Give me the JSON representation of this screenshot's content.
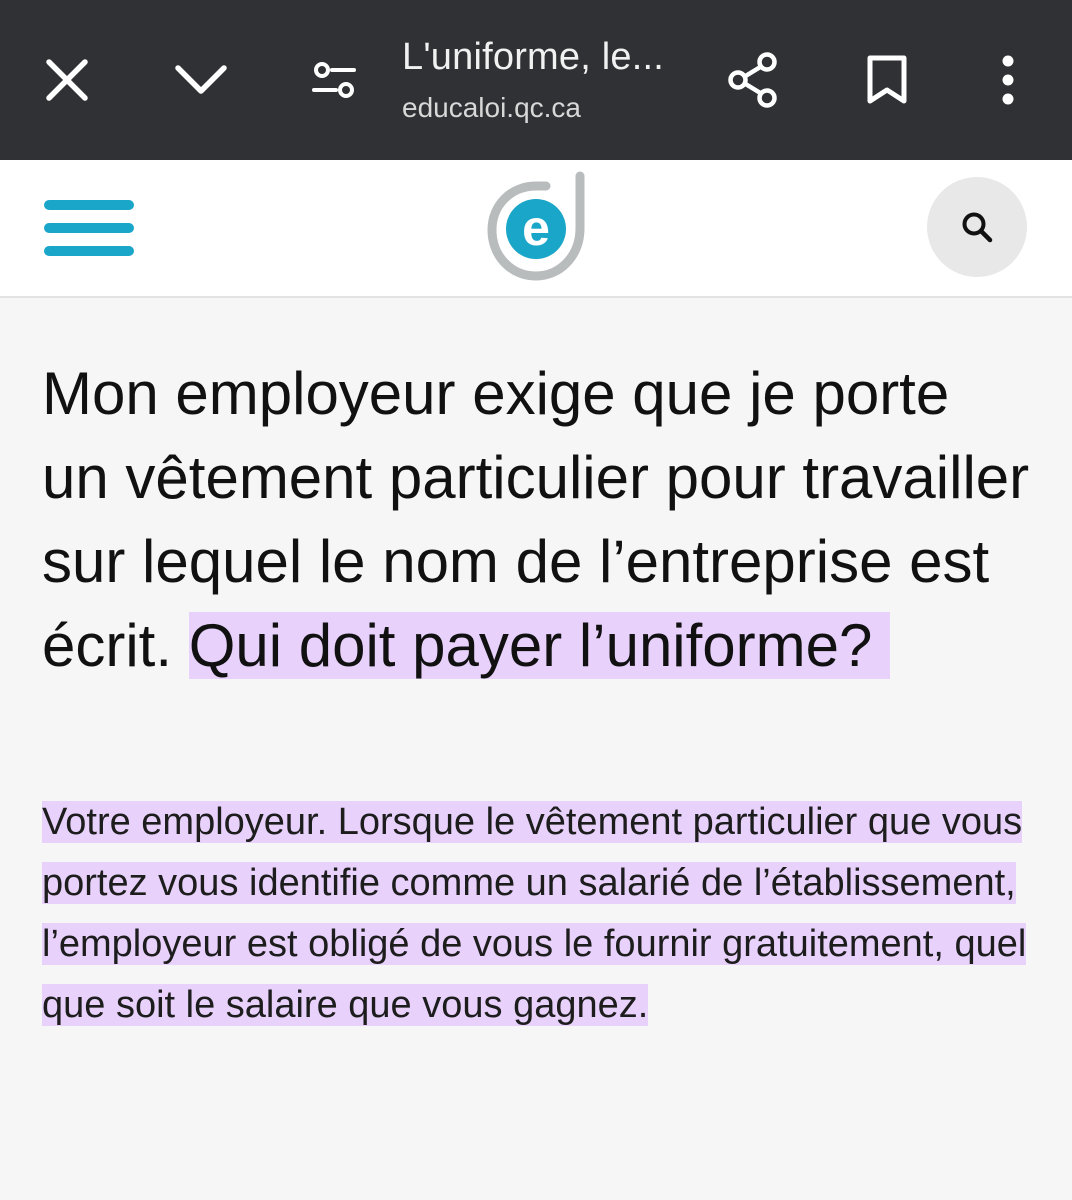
{
  "browser": {
    "page_title": "L'uniforme, le...",
    "url": "educaloi.qc.ca",
    "icons": {
      "close": "close-icon",
      "minimize": "chevron-down-icon",
      "site_settings": "tune-icon",
      "share": "share-icon",
      "bookmark": "bookmark-icon",
      "more": "more-vert-icon"
    }
  },
  "site": {
    "logo_letter": "e",
    "menu_icon": "hamburger-icon",
    "search_icon": "search-icon",
    "brand_color": "#1aa6c8"
  },
  "article": {
    "question_plain": "Mon employeur exige que je porte un vêtement particulier pour travailler sur lequel le nom de l’entreprise est écrit. ",
    "question_highlight": "Qui doit payer l’uniforme?",
    "answer": "Votre employeur. Lorsque le vêtement particulier que vous portez vous identifie comme un salarié de l’établissement, l’employeur est obligé de vous le fournir gratuitement, quel que soit le salaire que vous gagnez.",
    "highlight_color": "#e8d1fb"
  }
}
